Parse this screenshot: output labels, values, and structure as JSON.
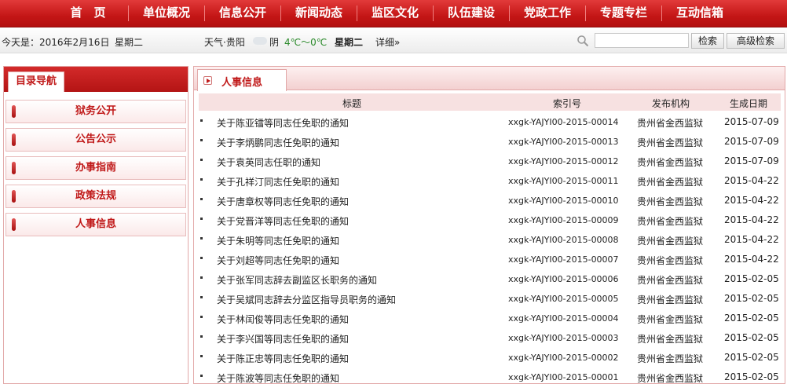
{
  "nav": {
    "items": [
      "首　页",
      "单位概况",
      "信息公开",
      "新闻动态",
      "监区文化",
      "队伍建设",
      "党政工作",
      "专题专栏",
      "互动信箱"
    ]
  },
  "infobar": {
    "today": "今天是：2016年2月16日",
    "weekday": "星期二",
    "weather_label": "天气·贵阳",
    "condition": "阴",
    "temperature": "4℃～0℃",
    "weather_weekday": "星期二",
    "detail_link": "详细»"
  },
  "search": {
    "value": "",
    "placeholder": "",
    "search_button": "检索",
    "advanced_button": "高级检索"
  },
  "sidebar": {
    "title": "目录导航",
    "items": [
      "狱务公开",
      "公告公示",
      "办事指南",
      "政策法规",
      "人事信息"
    ]
  },
  "main": {
    "tab_title": "人事信息",
    "columns": [
      "标题",
      "索引号",
      "发布机构",
      "生成日期"
    ],
    "rows": [
      {
        "title": "关于陈亚镭等同志任免职的通知",
        "index": "xxgk-YAJYI00-2015-00014",
        "org": "贵州省金西监狱",
        "date": "2015-07-09"
      },
      {
        "title": "关于李炳鹏同志任免职的通知",
        "index": "xxgk-YAJYI00-2015-00013",
        "org": "贵州省金西监狱",
        "date": "2015-07-09"
      },
      {
        "title": "关于袁英同志任职的通知",
        "index": "xxgk-YAJYI00-2015-00012",
        "org": "贵州省金西监狱",
        "date": "2015-07-09"
      },
      {
        "title": "关于孔祥汀同志任免职的通知",
        "index": "xxgk-YAJYI00-2015-00011",
        "org": "贵州省金西监狱",
        "date": "2015-04-22"
      },
      {
        "title": "关于唐章权等同志任免职的通知",
        "index": "xxgk-YAJYI00-2015-00010",
        "org": "贵州省金西监狱",
        "date": "2015-04-22"
      },
      {
        "title": "关于党晋洋等同志任免职的通知",
        "index": "xxgk-YAJYI00-2015-00009",
        "org": "贵州省金西监狱",
        "date": "2015-04-22"
      },
      {
        "title": "关于朱明等同志任免职的通知",
        "index": "xxgk-YAJYI00-2015-00008",
        "org": "贵州省金西监狱",
        "date": "2015-04-22"
      },
      {
        "title": "关于刘超等同志任免职的通知",
        "index": "xxgk-YAJYI00-2015-00007",
        "org": "贵州省金西监狱",
        "date": "2015-04-22"
      },
      {
        "title": "关于张军同志辞去副监区长职务的通知",
        "index": "xxgk-YAJYI00-2015-00006",
        "org": "贵州省金西监狱",
        "date": "2015-02-05"
      },
      {
        "title": "关于吴斌同志辞去分监区指导员职务的通知",
        "index": "xxgk-YAJYI00-2015-00005",
        "org": "贵州省金西监狱",
        "date": "2015-02-05"
      },
      {
        "title": "关于林闰俊等同志任免职的通知",
        "index": "xxgk-YAJYI00-2015-00004",
        "org": "贵州省金西监狱",
        "date": "2015-02-05"
      },
      {
        "title": "关于李兴国等同志任免职的通知",
        "index": "xxgk-YAJYI00-2015-00003",
        "org": "贵州省金西监狱",
        "date": "2015-02-05"
      },
      {
        "title": "关于陈正忠等同志任免职的通知",
        "index": "xxgk-YAJYI00-2015-00002",
        "org": "贵州省金西监狱",
        "date": "2015-02-05"
      },
      {
        "title": "关于陈波等同志任免职的通知",
        "index": "xxgk-YAJYI00-2015-00001",
        "org": "贵州省金西监狱",
        "date": "2015-02-05"
      }
    ]
  },
  "colors": {
    "brand_red": "#c41616",
    "accent_text": "#c01919",
    "temperature_color": "#2b8a2b"
  }
}
